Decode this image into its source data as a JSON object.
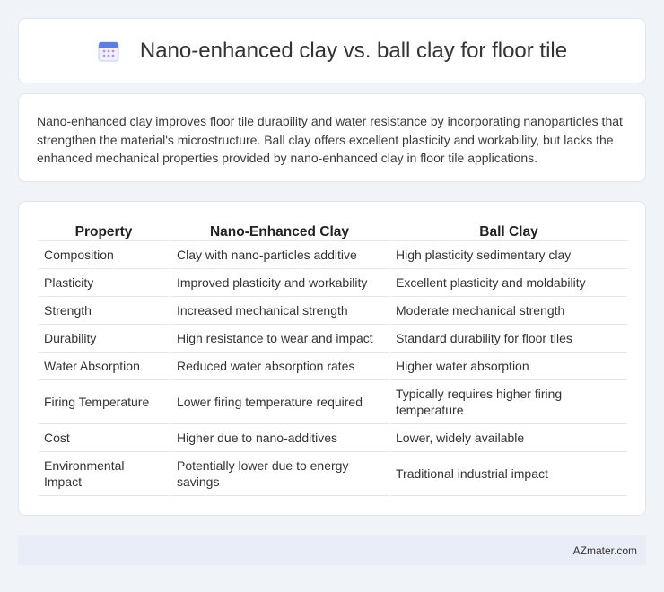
{
  "header": {
    "title": "Nano-enhanced clay vs. ball clay for floor tile",
    "icon": "calendar-icon"
  },
  "intro": {
    "text": "Nano-enhanced clay improves floor tile durability and water resistance by incorporating nanoparticles that strengthen the material's microstructure. Ball clay offers excellent plasticity and workability, but lacks the enhanced mechanical properties provided by nano-enhanced clay in floor tile applications."
  },
  "table": {
    "headers": [
      "Property",
      "Nano-Enhanced Clay",
      "Ball Clay"
    ],
    "rows": [
      [
        "Composition",
        "Clay with nano-particles additive",
        "High plasticity sedimentary clay"
      ],
      [
        "Plasticity",
        "Improved plasticity and workability",
        "Excellent plasticity and moldability"
      ],
      [
        "Strength",
        "Increased mechanical strength",
        "Moderate mechanical strength"
      ],
      [
        "Durability",
        "High resistance to wear and impact",
        "Standard durability for floor tiles"
      ],
      [
        "Water Absorption",
        "Reduced water absorption rates",
        "Higher water absorption"
      ],
      [
        "Firing Temperature",
        "Lower firing temperature required",
        "Typically requires higher firing temperature"
      ],
      [
        "Cost",
        "Higher due to nano-additives",
        "Lower, widely available"
      ],
      [
        "Environmental Impact",
        "Potentially lower due to energy savings",
        "Traditional industrial impact"
      ]
    ]
  },
  "footer": {
    "text": "AZmater.com"
  }
}
